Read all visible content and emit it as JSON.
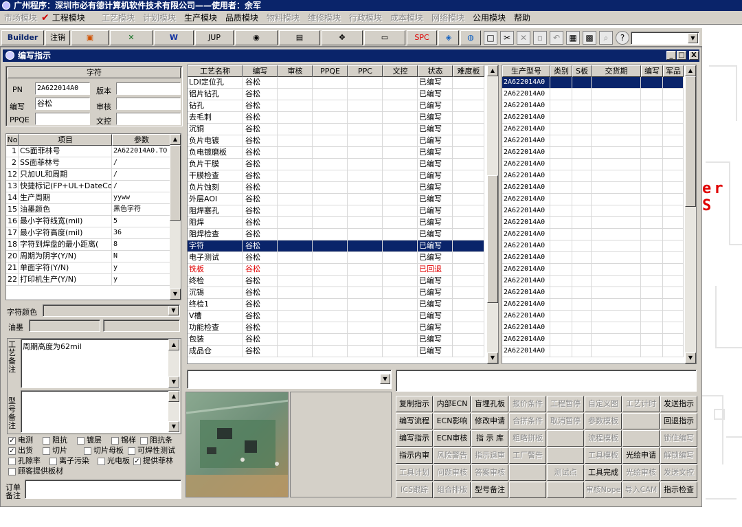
{
  "app_title": "广州程序：深圳市必有德计算机软件技术有限公司——使用者：余军",
  "menu": {
    "items": [
      {
        "label": "市场模块",
        "enabled": false
      },
      {
        "label": "工程模块",
        "enabled": true,
        "checked": true
      },
      {
        "label": "工艺模块",
        "enabled": false
      },
      {
        "label": "计划模块",
        "enabled": false
      },
      {
        "label": "生产模块",
        "enabled": true
      },
      {
        "label": "品质模块",
        "enabled": true
      },
      {
        "label": "物料模块",
        "enabled": false
      },
      {
        "label": "维修模块",
        "enabled": false
      },
      {
        "label": "行政模块",
        "enabled": false
      },
      {
        "label": "成本模块",
        "enabled": false
      },
      {
        "label": "网络模块",
        "enabled": false
      },
      {
        "label": "公用模块",
        "enabled": true
      },
      {
        "label": "帮助",
        "enabled": true
      }
    ],
    "check_mark": "✔"
  },
  "toolbar": {
    "builder_label": "Builder",
    "logout_label": "注销",
    "jup_label": "JUP",
    "spc_label": "SPC",
    "glyphs": [
      "▣",
      "✕",
      "W",
      "",
      "◉",
      "▤",
      "✥",
      "",
      "▭",
      "◈",
      "◍",
      "□",
      "✂",
      "✕",
      "▫",
      "↶",
      "▦",
      "▩",
      "?"
    ]
  },
  "child_window": {
    "title": "编写指示",
    "min": "_",
    "max": "□",
    "close": "X"
  },
  "info": {
    "header": "字符",
    "pn_label": "PN",
    "pn_value": "2A622014A0",
    "version_label": "版本",
    "version_value": "",
    "writer_label": "编写",
    "writer_value": "谷松",
    "review_label": "审核",
    "review_value": "",
    "ppqe_label": "PPQE",
    "ppqe_value": "",
    "doc_label": "文控",
    "doc_value": ""
  },
  "params": {
    "headers": [
      "No",
      "项目",
      "参数"
    ],
    "rows": [
      [
        "1",
        "CS面菲林号",
        "2A622014A0.TO"
      ],
      [
        "2",
        "SS面菲林号",
        "/"
      ],
      [
        "12",
        "只加UL和周期",
        "/"
      ],
      [
        "13",
        "快捷标记(FP+UL+DateCo",
        "/"
      ],
      [
        "14",
        "生产周期",
        "yyww"
      ],
      [
        "15",
        "油墨颜色",
        "黑色字符"
      ],
      [
        "16",
        "最小字符线宽(mil)",
        "5"
      ],
      [
        "17",
        "最小字符高度(mil)",
        "36"
      ],
      [
        "18",
        "字符到焊盘的最小距离(",
        "8"
      ],
      [
        "20",
        "周期为阴字(Y/N)",
        "N"
      ],
      [
        "21",
        "单面字符(Y/N)",
        "y"
      ],
      [
        "22",
        "打印机生产(Y/N)",
        "y"
      ]
    ]
  },
  "char_color_label": "字符颜色",
  "ink_label": "油墨",
  "process_note_label": "工艺备注",
  "process_note_value": "周期高度为62mil",
  "model_note_label": "型号备注",
  "order_note_label": "订单备注",
  "checkboxes": [
    {
      "label": "电测",
      "checked": true
    },
    {
      "label": "阻抗",
      "checked": false
    },
    {
      "label": "镀层",
      "checked": false
    },
    {
      "label": "锡样",
      "checked": false
    },
    {
      "label": "阻抗条",
      "checked": false
    },
    {
      "label": "出货",
      "checked": true
    },
    {
      "label": "切片",
      "checked": false
    },
    {
      "label": "切片母板",
      "checked": false
    },
    {
      "label": "可焊性测试",
      "checked": false
    },
    {
      "label": "孔隙率",
      "checked": false
    },
    {
      "label": "离子污染",
      "checked": false
    },
    {
      "label": "光电板",
      "checked": false
    },
    {
      "label": "提供菲林",
      "checked": true
    },
    {
      "label": "顾客提供板材",
      "checked": false
    }
  ],
  "process_grid": {
    "headers": [
      "工艺名称",
      "编写",
      "审核",
      "PPQE",
      "PPC",
      "文控",
      "状态",
      "难度板"
    ],
    "rows": [
      {
        "name": "LDI定位孔",
        "writer": "谷松",
        "status": "已编写"
      },
      {
        "name": "铝片钻孔",
        "writer": "谷松",
        "status": "已编写"
      },
      {
        "name": "钻孔",
        "writer": "谷松",
        "status": "已编写"
      },
      {
        "name": "去毛刺",
        "writer": "谷松",
        "status": "已编写"
      },
      {
        "name": "沉铜",
        "writer": "谷松",
        "status": "已编写"
      },
      {
        "name": "负片电镀",
        "writer": "谷松",
        "status": "已编写"
      },
      {
        "name": "负电镀磨板",
        "writer": "谷松",
        "status": "已编写"
      },
      {
        "name": "负片干膜",
        "writer": "谷松",
        "status": "已编写"
      },
      {
        "name": "干膜检查",
        "writer": "谷松",
        "status": "已编写"
      },
      {
        "name": "负片蚀刻",
        "writer": "谷松",
        "status": "已编写"
      },
      {
        "name": "外层AOI",
        "writer": "谷松",
        "status": "已编写"
      },
      {
        "name": "阻焊塞孔",
        "writer": "谷松",
        "status": "已编写"
      },
      {
        "name": "阻焊",
        "writer": "谷松",
        "status": "已编写"
      },
      {
        "name": "阻焊检查",
        "writer": "谷松",
        "status": "已编写"
      },
      {
        "name": "字符",
        "writer": "谷松",
        "status": "已编写",
        "selected": true
      },
      {
        "name": "电子测试",
        "writer": "谷松",
        "status": "已编写"
      },
      {
        "name": "铣板",
        "writer": "谷松",
        "status": "已回退",
        "red": true
      },
      {
        "name": "终检",
        "writer": "谷松",
        "status": "已编写"
      },
      {
        "name": "沉锡",
        "writer": "谷松",
        "status": "已编写"
      },
      {
        "name": "终检1",
        "writer": "谷松",
        "status": "已编写"
      },
      {
        "name": "V槽",
        "writer": "谷松",
        "status": "已编写"
      },
      {
        "name": "功能检查",
        "writer": "谷松",
        "status": "已编写"
      },
      {
        "name": "包装",
        "writer": "谷松",
        "status": "已编写"
      },
      {
        "name": "成品仓",
        "writer": "谷松",
        "status": "已编写"
      }
    ]
  },
  "model_grid": {
    "headers": [
      "生产型号",
      "类别",
      "S板",
      "交货期",
      "编写",
      "军品"
    ],
    "rows": [
      "2A622014A0",
      "2A622014A0",
      "2A622014A0",
      "2A622014A0",
      "2A622014A0",
      "2A622014A0",
      "2A622014A0",
      "2A622014A0",
      "2A622014A0",
      "2A622014A0",
      "2A622014A0",
      "2A622014A0",
      "2A622014A0",
      "2A622014A0",
      "2A622014A0",
      "2A622014A0",
      "2A622014A0",
      "2A622014A0",
      "2A622014A0",
      "2A622014A0",
      "2A622014A0",
      "2A622014A0",
      "2A622014A0",
      "2A622014A0"
    ]
  },
  "backdrop_text": "er S",
  "actions": [
    [
      {
        "l": "复制指示",
        "e": true
      },
      {
        "l": "内部ECN",
        "e": true
      },
      {
        "l": "盲埋孔板",
        "e": true
      },
      {
        "l": "报价条件",
        "e": false
      },
      {
        "l": "工程暂停",
        "e": false
      },
      {
        "l": "自定义图",
        "e": false
      },
      {
        "l": "工艺计时",
        "e": false
      },
      {
        "l": "发送指示",
        "e": true
      }
    ],
    [
      {
        "l": "编写流程",
        "e": true
      },
      {
        "l": "ECN影响",
        "e": true
      },
      {
        "l": "修改申请",
        "e": true
      },
      {
        "l": "合拼条件",
        "e": false
      },
      {
        "l": "取消暂停",
        "e": false
      },
      {
        "l": "参数模板",
        "e": false
      },
      {
        "l": "",
        "e": false
      },
      {
        "l": "回退指示",
        "e": true
      }
    ],
    [
      {
        "l": "编写指示",
        "e": true
      },
      {
        "l": "ECN审核",
        "e": true
      },
      {
        "l": "指 示 库",
        "e": true
      },
      {
        "l": "粗略拼板",
        "e": false
      },
      {
        "l": "",
        "e": false
      },
      {
        "l": "流程模板",
        "e": false
      },
      {
        "l": "",
        "e": false
      },
      {
        "l": "锁住编写",
        "e": false
      }
    ],
    [
      {
        "l": "指示内审",
        "e": true
      },
      {
        "l": "风险警告",
        "e": false
      },
      {
        "l": "指示退审",
        "e": false
      },
      {
        "l": "工厂警告",
        "e": false
      },
      {
        "l": "",
        "e": false
      },
      {
        "l": "工具模板",
        "e": false
      },
      {
        "l": "光绘申请",
        "e": true
      },
      {
        "l": "解锁编写",
        "e": false
      }
    ],
    [
      {
        "l": "工具计划",
        "e": false
      },
      {
        "l": "问题审核",
        "e": false
      },
      {
        "l": "答案审核",
        "e": false
      },
      {
        "l": "",
        "e": false
      },
      {
        "l": "测试点",
        "e": false
      },
      {
        "l": "工具完成",
        "e": true
      },
      {
        "l": "光绘审核",
        "e": false
      },
      {
        "l": "发送文控",
        "e": false
      }
    ],
    [
      {
        "l": "ICS跟踪",
        "e": false
      },
      {
        "l": "组合排版",
        "e": false
      },
      {
        "l": "型号备注",
        "e": true
      },
      {
        "l": "",
        "e": false
      },
      {
        "l": "",
        "e": false
      },
      {
        "l": "审核Nope",
        "e": false
      },
      {
        "l": "导入CAM",
        "e": false
      },
      {
        "l": "指示检查",
        "e": true
      }
    ]
  ]
}
